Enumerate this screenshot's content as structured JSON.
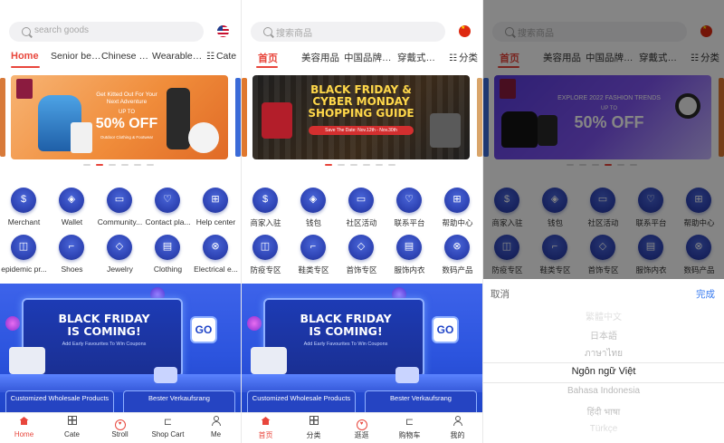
{
  "colors": {
    "accent": "#e8463c",
    "promo_blue": "#2c54de",
    "link_blue": "#3a7cf0"
  },
  "panels": [
    {
      "search_placeholder": "search goods",
      "flag": "us-flag-icon",
      "tabs": [
        "Home",
        "Senior bea...",
        "Chinese Br...",
        "Wearable ..."
      ],
      "cate_tab": "Cate",
      "banner": {
        "line1": "Get Kitted Out For Your",
        "line2": "Next Adventure",
        "up_to": "UP TO",
        "discount": "50% OFF",
        "small": "Outdoor Clothing & Footwear"
      },
      "grid": [
        {
          "label": "Merchant",
          "icon": "merchant-icon"
        },
        {
          "label": "Wallet",
          "icon": "wallet-icon"
        },
        {
          "label": "Community...",
          "icon": "community-icon"
        },
        {
          "label": "Contact pla...",
          "icon": "contact-icon"
        },
        {
          "label": "Help center",
          "icon": "help-center-icon"
        },
        {
          "label": "epidemic pr...",
          "icon": "epidemic-icon"
        },
        {
          "label": "Shoes",
          "icon": "shoes-icon"
        },
        {
          "label": "Jewelry",
          "icon": "jewelry-icon"
        },
        {
          "label": "Clothing",
          "icon": "clothing-icon"
        },
        {
          "label": "Electrical e...",
          "icon": "electrical-icon"
        }
      ],
      "promo": {
        "title1": "BLACK FRIDAY",
        "title2": "IS COMING!",
        "sub": "Add Early Favourites To Win Coupons",
        "go": "GO",
        "card_left": "Customized Wholesale Products",
        "card_right": "Bester Verkaufsrang"
      },
      "nav": [
        "Home",
        "Cate",
        "Stroll",
        "Shop Cart",
        "Me"
      ]
    },
    {
      "search_placeholder": "搜索商品",
      "flag": "china-flag-icon",
      "tabs": [
        "首页",
        "美容用品",
        "中国品牌手机",
        "穿戴式科技"
      ],
      "cate_tab": "分类",
      "banner": {
        "line1": "BLACK FRIDAY &",
        "line2": "CYBER MONDAY",
        "line3": "SHOPPING GUIDE",
        "date": "Save The Date: Nov.12th - Nov.30th"
      },
      "grid": [
        {
          "label": "商家入驻",
          "icon": "merchant-icon"
        },
        {
          "label": "钱包",
          "icon": "wallet-icon"
        },
        {
          "label": "社区活动",
          "icon": "community-icon"
        },
        {
          "label": "联系平台",
          "icon": "contact-icon"
        },
        {
          "label": "帮助中心",
          "icon": "help-center-icon"
        },
        {
          "label": "防疫专区",
          "icon": "epidemic-icon"
        },
        {
          "label": "鞋类专区",
          "icon": "shoes-icon"
        },
        {
          "label": "首饰专区",
          "icon": "jewelry-icon"
        },
        {
          "label": "服饰内衣",
          "icon": "clothing-icon"
        },
        {
          "label": "数码产品",
          "icon": "electrical-icon"
        }
      ],
      "promo": {
        "title1": "BLACK FRIDAY",
        "title2": "IS COMING!",
        "sub": "Add Early Favourites To Win Coupons",
        "go": "GO",
        "card_left": "Customized Wholesale Products",
        "card_right": "Bester Verkaufsrang"
      },
      "nav": [
        "首页",
        "分类",
        "逛逛",
        "购物车",
        "我的"
      ]
    },
    {
      "search_placeholder": "搜索商品",
      "flag": "china-flag-icon",
      "tabs": [
        "首页",
        "美容用品",
        "中国品牌手机",
        "穿戴式科技"
      ],
      "cate_tab": "分类",
      "banner": {
        "line1": "EXPLORE 2022 FASHION TRENDS",
        "up_to": "UP TO",
        "discount": "50% OFF"
      },
      "grid": [
        {
          "label": "商家入驻",
          "icon": "merchant-icon"
        },
        {
          "label": "钱包",
          "icon": "wallet-icon"
        },
        {
          "label": "社区活动",
          "icon": "community-icon"
        },
        {
          "label": "联系平台",
          "icon": "contact-icon"
        },
        {
          "label": "帮助中心",
          "icon": "help-center-icon"
        },
        {
          "label": "防疫专区",
          "icon": "epidemic-icon"
        },
        {
          "label": "鞋类专区",
          "icon": "shoes-icon"
        },
        {
          "label": "首饰专区",
          "icon": "jewelry-icon"
        },
        {
          "label": "服饰内衣",
          "icon": "clothing-icon"
        },
        {
          "label": "数码产品",
          "icon": "electrical-icon"
        }
      ],
      "picker": {
        "cancel": "取消",
        "done": "完成",
        "options": [
          "繁體中文",
          "日本語",
          "ภาษาไทย",
          "Ngôn ngữ Việt",
          "Bahasa Indonesia",
          "हिंदी भाषा",
          "Türkçe"
        ],
        "selected_index": 3
      }
    }
  ]
}
